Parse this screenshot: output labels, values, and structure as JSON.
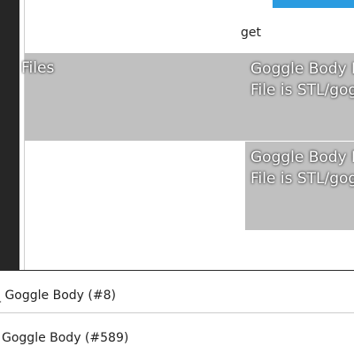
{
  "top_text": "get",
  "files_section": {
    "label": "Files"
  },
  "thumbnails": [
    {
      "title": "Goggle Body L",
      "subtitle": "File is STL/gog"
    },
    {
      "title": "Goggle Body R",
      "subtitle": "File is STL/gog"
    }
  ],
  "list_items": [
    {
      "label": "_ Goggle Body (#8)"
    },
    {
      "label": "Goggle Body (#589)"
    }
  ],
  "colors": {
    "accent": "#2a9be0",
    "sidebar_dark": "#262626",
    "tile_gray": "#c0c0c0"
  }
}
